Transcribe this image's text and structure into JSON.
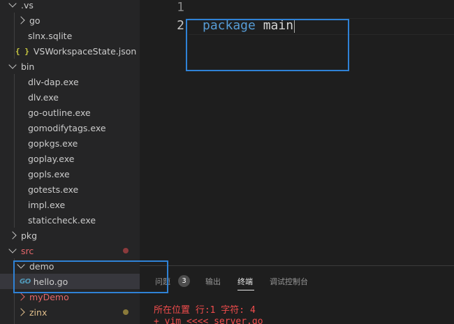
{
  "explorer": {
    "items": [
      {
        "label": ".vs",
        "type": "folder",
        "expanded": true,
        "depth": 0
      },
      {
        "label": "go",
        "type": "folder",
        "expanded": false,
        "depth": 1
      },
      {
        "label": "slnx.sqlite",
        "type": "file",
        "depth": 1
      },
      {
        "label": "VSWorkspaceState.json",
        "type": "json",
        "depth": 1
      },
      {
        "label": "bin",
        "type": "folder",
        "expanded": true,
        "depth": 0
      },
      {
        "label": "dlv-dap.exe",
        "type": "file",
        "depth": 1
      },
      {
        "label": "dlv.exe",
        "type": "file",
        "depth": 1
      },
      {
        "label": "go-outline.exe",
        "type": "file",
        "depth": 1
      },
      {
        "label": "gomodifytags.exe",
        "type": "file",
        "depth": 1
      },
      {
        "label": "gopkgs.exe",
        "type": "file",
        "depth": 1
      },
      {
        "label": "goplay.exe",
        "type": "file",
        "depth": 1
      },
      {
        "label": "gopls.exe",
        "type": "file",
        "depth": 1
      },
      {
        "label": "gotests.exe",
        "type": "file",
        "depth": 1
      },
      {
        "label": "impl.exe",
        "type": "file",
        "depth": 1
      },
      {
        "label": "staticcheck.exe",
        "type": "file",
        "depth": 1
      },
      {
        "label": "pkg",
        "type": "folder",
        "expanded": false,
        "depth": 0
      },
      {
        "label": "src",
        "type": "folder",
        "expanded": true,
        "depth": 0,
        "status": "error"
      },
      {
        "label": "demo",
        "type": "folder",
        "expanded": true,
        "depth": 1
      },
      {
        "label": "hello.go",
        "type": "go",
        "depth": 2,
        "selected": true
      },
      {
        "label": "myDemo",
        "type": "folder",
        "expanded": false,
        "depth": 1,
        "status": "error"
      },
      {
        "label": "zinx",
        "type": "folder",
        "expanded": false,
        "depth": 1,
        "status": "warning"
      }
    ],
    "go_icon_text": "GO",
    "json_icon_text": "{ }"
  },
  "editor": {
    "line_numbers": [
      "1",
      "2"
    ],
    "line2_keyword": "package",
    "line2_ident": "main"
  },
  "panel": {
    "tabs": [
      {
        "label": "问题",
        "badge": "3"
      },
      {
        "label": "输出"
      },
      {
        "label": "终端",
        "active": true
      },
      {
        "label": "调试控制台"
      }
    ],
    "terminal_lines": [
      "所在位置 行:1 字符: 4",
      "+ vim <<<<  server.go"
    ]
  },
  "colors": {
    "sidebar_bg": "#252526",
    "editor_bg": "#1e1e1e",
    "keyword": "#569cd6",
    "error": "#e4676b",
    "warning": "#e2c08d",
    "terminal_error": "#f14c4c",
    "annotation_box": "#2f82d6"
  }
}
